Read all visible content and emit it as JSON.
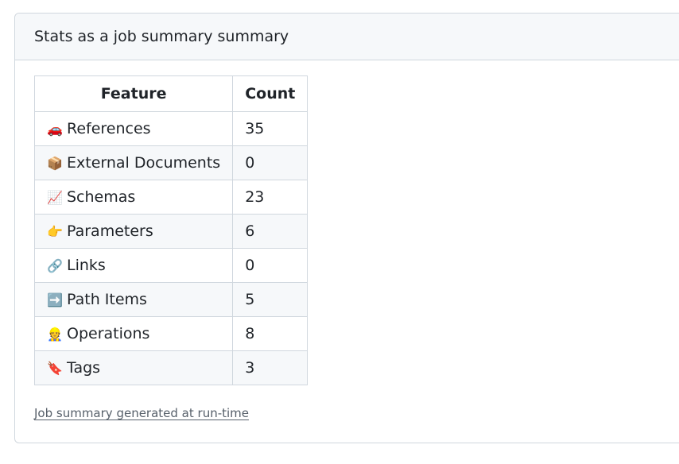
{
  "summary": {
    "title": "Stats as a job summary summary",
    "footer": "Job summary generated at run-time"
  },
  "table": {
    "headers": {
      "feature": "Feature",
      "count": "Count"
    },
    "rows": [
      {
        "icon": "🚗",
        "icon_name": "car-icon",
        "feature": "References",
        "count": "35"
      },
      {
        "icon": "📦",
        "icon_name": "package-icon",
        "feature": "External Documents",
        "count": "0"
      },
      {
        "icon": "📈",
        "icon_name": "chart-increasing-icon",
        "feature": "Schemas",
        "count": "23"
      },
      {
        "icon": "👉",
        "icon_name": "pointing-right-icon",
        "feature": "Parameters",
        "count": "6"
      },
      {
        "icon": "🔗",
        "icon_name": "link-icon",
        "feature": "Links",
        "count": "0"
      },
      {
        "icon": "➡️",
        "icon_name": "right-arrow-icon",
        "feature": "Path Items",
        "count": "5"
      },
      {
        "icon": "👷",
        "icon_name": "construction-worker-icon",
        "feature": "Operations",
        "count": "8"
      },
      {
        "icon": "🔖",
        "icon_name": "bookmark-icon",
        "feature": "Tags",
        "count": "3"
      }
    ]
  }
}
